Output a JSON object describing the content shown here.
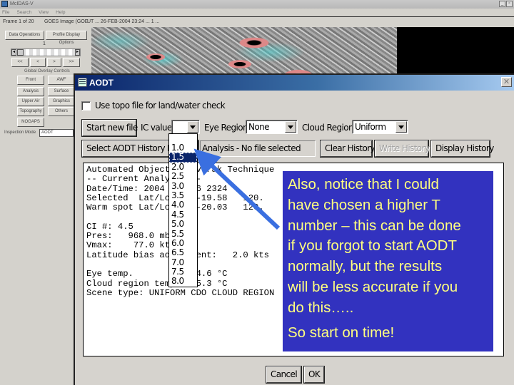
{
  "background_app": {
    "title": "McIDAS-V",
    "menu": [
      "File",
      "Search",
      "View",
      "Help"
    ],
    "status": {
      "frame": "Frame 1 of 20",
      "image": "GOES Image (GOE",
      "datetime": "UT ... 26-FEB-2004 23:24 ... 1 ..."
    },
    "buttons_top": [
      "Data Operations",
      "Profile Display Options"
    ],
    "frame_number": "1",
    "nav_buttons": [
      "<<",
      "<",
      ">",
      ">>"
    ],
    "overlay_title": "Global Overlay Controls",
    "overlay_buttons": [
      "Front",
      "AWF",
      "Analysis",
      "Surface",
      "Upper Air",
      "Graphics",
      "Topography",
      "Others",
      "NOGAPS"
    ],
    "inspect_label": "Inspection Mode",
    "inspect_value": "AODT"
  },
  "dialog": {
    "title": "AODT",
    "topo_checkbox_label": "Use topo file for land/water check",
    "topo_checked": false,
    "start_new_file": "Start new file",
    "ic_value_label": "IC value",
    "ic_value": "",
    "eye_region_label": "Eye Region",
    "eye_region_value": "None",
    "cloud_region_label": "Cloud Region",
    "cloud_region_value": "Uniform",
    "select_history": "Select AODT History File",
    "analysis_status": "Analysis - No file selected",
    "clear_history": "Clear History",
    "write_history": "Write History",
    "display_history": "Display History",
    "output_lines": [
      "Automated Objective Dvorak Technique",
      "-- Current Analysis --",
      "Date/Time: 2004 Feb 26 2324",
      "Selected  Lat/Lon:   -19.58   120.",
      "Warm spot Lat/Lon:   -20.03   120.",
      "",
      "CI #: 4.5",
      "Pres:   968.0 mb",
      "Vmax:    77.0 kts",
      "Latitude bias adjustment:   2.0 kts",
      "",
      "Eye temp.          -74.6 °C",
      "Cloud region temp. -75.3 °C",
      "Scene type: UNIFORM CDO CLOUD REGION"
    ],
    "cancel": "Cancel",
    "ok": "OK",
    "ic_dropdown": {
      "options": [
        "",
        "1.0",
        "1.5",
        "2.0",
        "2.5",
        "3.0",
        "3.5",
        "4.0",
        "4.5",
        "5.0",
        "5.5",
        "6.0",
        "6.5",
        "7.0",
        "7.5",
        "8.0"
      ],
      "highlighted": "1.5"
    }
  },
  "annotation": {
    "text": "Also, notice that I could have chosen a higher T number – this can be done if you forgot to start AODT normally, but the results will be less accurate if you do this…..",
    "lines": [
      "Also, notice that I could",
      "have chosen a higher T",
      "number – this can be done",
      "if you forgot to start AODT",
      "normally, but the results",
      "will be less accurate if you",
      "do this….."
    ],
    "emphasis": "So start on time!",
    "background_color": "#3232bf",
    "text_color": "#ffff80",
    "arrow_color": "#3a6fe0"
  }
}
